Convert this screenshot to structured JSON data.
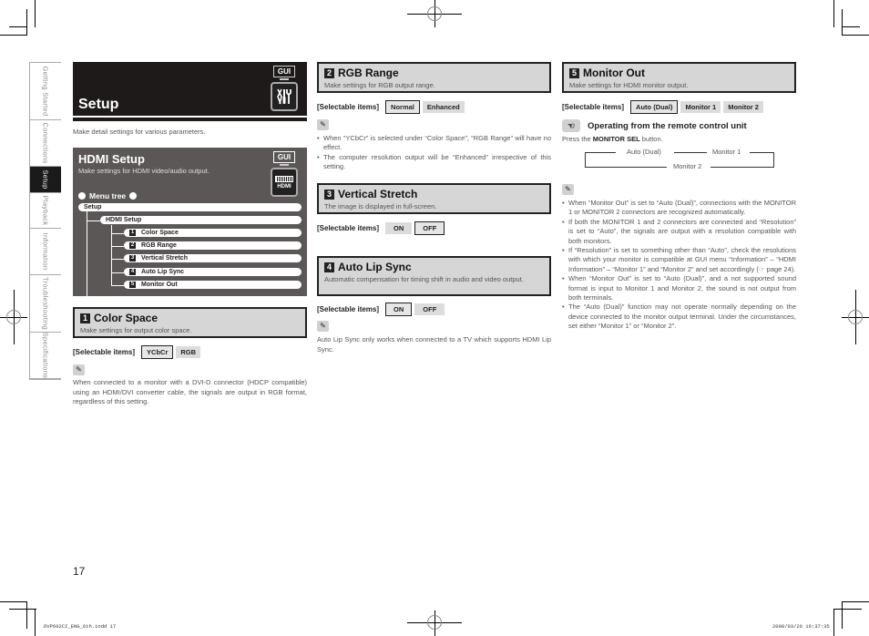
{
  "sidebar": {
    "tabs": [
      {
        "label": "Getting Started",
        "active": false
      },
      {
        "label": "Connections",
        "active": false
      },
      {
        "label": "Setup",
        "active": true
      },
      {
        "label": "Playback",
        "active": false
      },
      {
        "label": "Information",
        "active": false
      },
      {
        "label": "Troubleshooting",
        "active": false
      },
      {
        "label": "Specifications",
        "active": false
      }
    ]
  },
  "setup": {
    "title": "Setup",
    "badge": "GUI",
    "icon": "tools-icon",
    "description": "Make detail settings for various parameters."
  },
  "hdmi_setup": {
    "title": "HDMI Setup",
    "subtitle": "Make settings for HDMI video/audio output.",
    "badge": "GUI",
    "icon_label": "HDMI",
    "menu_tree_label": "Menu tree",
    "tree": {
      "root": "Setup",
      "child": "HDMI Setup",
      "items": [
        {
          "num": "1",
          "label": "Color Space"
        },
        {
          "num": "2",
          "label": "RGB Range"
        },
        {
          "num": "3",
          "label": "Vertical Stretch"
        },
        {
          "num": "4",
          "label": "Auto Lip Sync"
        },
        {
          "num": "5",
          "label": "Monitor Out"
        }
      ]
    }
  },
  "selectable_label": "[Selectable items]",
  "sections": {
    "color_space": {
      "num": "1",
      "title": "Color Space",
      "desc": "Make settings for output color space.",
      "options": [
        "YCbCr",
        "RGB"
      ],
      "default": "YCbCr",
      "note": "When connected to a monitor with a DVI-D connector (HDCP compatible) using an HDMI/DVI converter cable, the signals are output in RGB format, regardless of this setting."
    },
    "rgb_range": {
      "num": "2",
      "title": "RGB Range",
      "desc": "Make settings for RGB output range.",
      "options": [
        "Normal",
        "Enhanced"
      ],
      "default": "Normal",
      "notes": [
        "When “YCbCr” is selected under “Color Space”, “RGB Range” will have no effect.",
        "The computer resolution output will be “Enhanced” irrespective of this setting."
      ]
    },
    "vertical_stretch": {
      "num": "3",
      "title": "Vertical Stretch",
      "desc": "The image is displayed in full-screen.",
      "options": [
        "ON",
        "OFF"
      ],
      "default": "OFF"
    },
    "auto_lip_sync": {
      "num": "4",
      "title": "Auto Lip Sync",
      "desc": "Automatic compensation for timing shift in audio and video output.",
      "options": [
        "ON",
        "OFF"
      ],
      "default": "ON",
      "note": "Auto Lip Sync only works when connected to a TV which supports HDMI Lip Sync."
    },
    "monitor_out": {
      "num": "5",
      "title": "Monitor Out",
      "desc": "Make settings for HDMI monitor output.",
      "options": [
        "Auto (Dual)",
        "Monitor 1",
        "Monitor 2"
      ],
      "default": "Auto (Dual)",
      "remote_title": "Operating from the remote control unit",
      "remote_press_prefix": "Press the ",
      "remote_button": "MONITOR SEL",
      "remote_press_suffix": " button.",
      "flow": [
        "Auto (Dual)",
        "Monitor 1",
        "Monitor 2"
      ],
      "notes": [
        "When “Monitor Out” is set to “Auto (Dual)”, connections with the MONITOR 1 or MONITOR 2 connectors are recognized automatically.",
        "If both the MONITOR 1 and 2 connectors are connected and “Resolution” is set to “Auto”, the signals are output with a resolution compatible with both monitors.",
        "If “Resolution” is set to something other than “Auto”, check the resolutions with which your monitor is compatible at GUI menu “Information” – “HDMI Information” – “Monitor 1” and “Monitor 2” and set accordingly (☞ page 24).",
        "When “Monitor Out” is set to “Auto (Dual)”, and a not supported sound format is input to Monitor 1 and Monitor 2, the sound is not output from both terminals.",
        "The “Auto (Dual)” function may not operate normally depending on the device connected to the monitor output terminal. Under the circumstances, set either “Monitor 1” or “Monitor 2”."
      ]
    }
  },
  "footer": {
    "page_number": "17",
    "slug_left": "DVP602CI_ENG_6th.indd   17",
    "slug_right": "2008/03/26   16:37:35"
  }
}
